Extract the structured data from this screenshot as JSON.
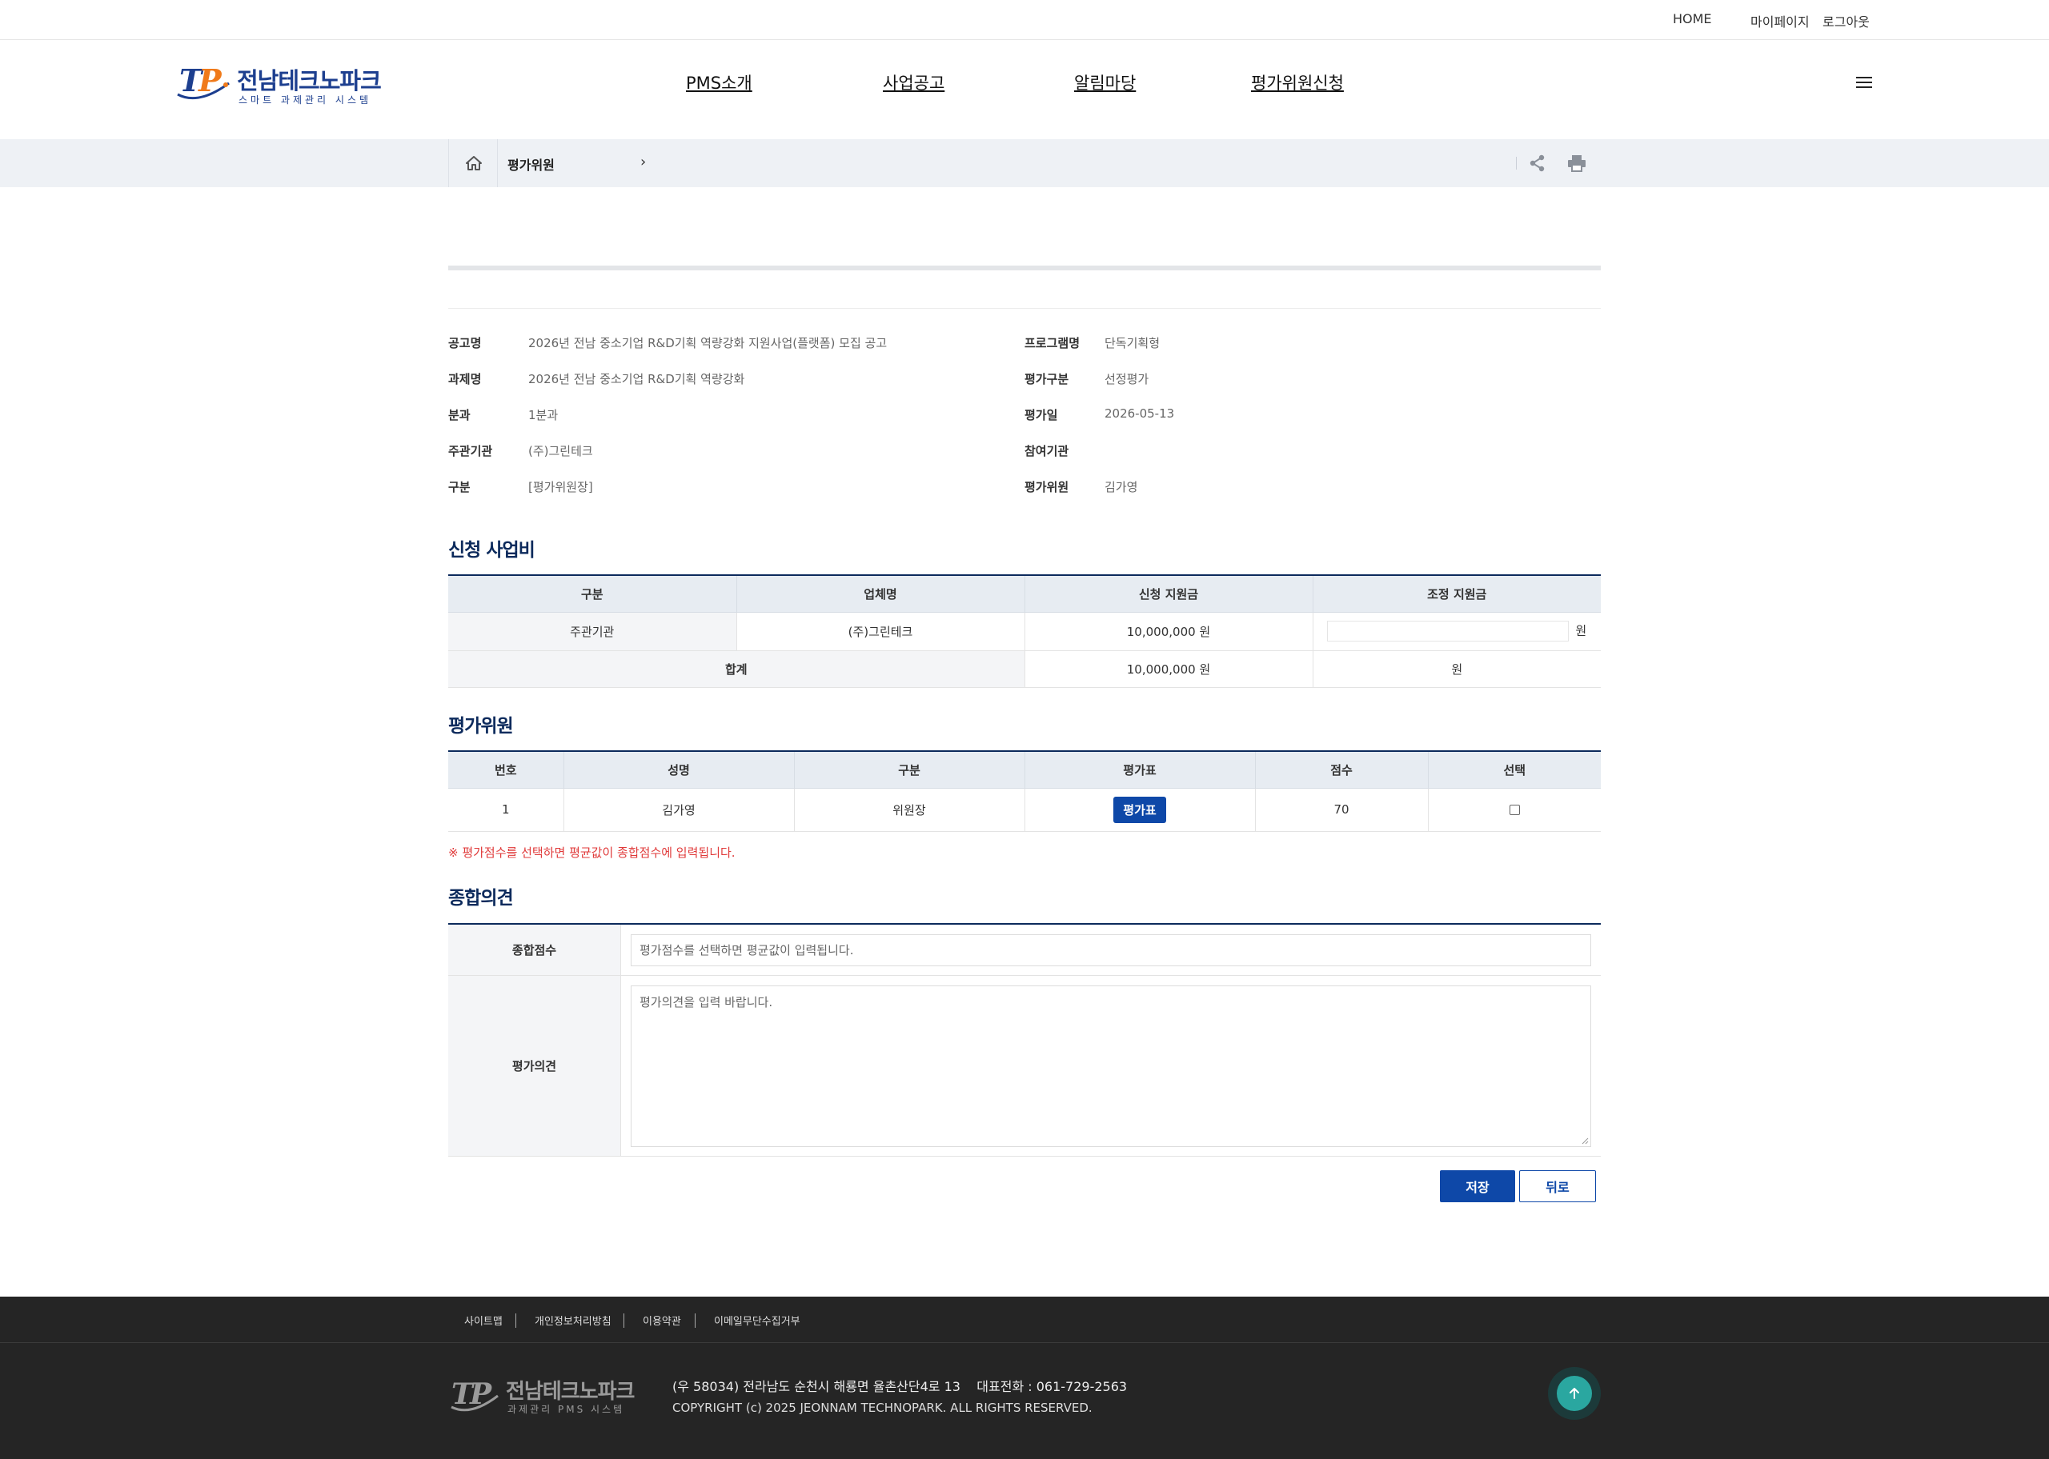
{
  "util_nav": {
    "home": "HOME",
    "mypage": "마이페이지",
    "logout": "로그아웃"
  },
  "logo": {
    "name": "전남테크노파크",
    "subtitle": "스마트 과제관리 시스템",
    "mark": "TP"
  },
  "gnb": [
    "PMS소개",
    "사업공고",
    "알림마당",
    "평가위원신청"
  ],
  "breadcrumb": {
    "current": "평가위원",
    "chevron": "›"
  },
  "info": {
    "left": [
      {
        "label": "공고명",
        "value": "2026년 전남 중소기업 R&D기획 역량강화 지원사업(플랫폼) 모집 공고"
      },
      {
        "label": "과제명",
        "value": "2026년 전남 중소기업 R&D기획 역량강화"
      },
      {
        "label": "분과",
        "value": "1분과"
      },
      {
        "label": "주관기관",
        "value": "(주)그린테크"
      },
      {
        "label": "구분",
        "value": "[평가위원장]"
      }
    ],
    "right": [
      {
        "label": "프로그램명",
        "value": "단독기획형"
      },
      {
        "label": "평가구분",
        "value": "선정평가"
      },
      {
        "label": "평가일",
        "value": "2026-05-13"
      },
      {
        "label": "참여기관",
        "value": ""
      },
      {
        "label": "평가위원",
        "value": "김가영"
      }
    ]
  },
  "budget": {
    "title": "신청 사업비",
    "headers": [
      "구분",
      "업체명",
      "신청 지원금",
      "조정 지원금"
    ],
    "rows": [
      {
        "type": "주관기관",
        "company": "(주)그린테크",
        "requested": "10,000,000 원",
        "adjusted_input": "",
        "adjusted_unit": "원"
      }
    ],
    "total": {
      "label": "합계",
      "requested": "10,000,000 원",
      "adjusted": "원"
    }
  },
  "evaluators": {
    "title": "평가위원",
    "headers": [
      "번호",
      "성명",
      "구분",
      "평가표",
      "점수",
      "선택"
    ],
    "rows": [
      {
        "no": "1",
        "name": "김가영",
        "role": "위원장",
        "sheet_button": "평가표",
        "score": "70",
        "selected": false
      }
    ],
    "notice": "※ 평가점수를 선택하면 평균값이 종합점수에 입력됩니다."
  },
  "opinion": {
    "title": "종합의견",
    "score_label": "종합점수",
    "score_placeholder": "평가점수를 선택하면 평균값이 입력됩니다.",
    "opinion_label": "평가의견",
    "opinion_placeholder": "평가의견을 입력 바랍니다."
  },
  "actions": {
    "save": "저장",
    "back": "뒤로"
  },
  "footer": {
    "links": [
      "사이트맵",
      "개인정보처리방침",
      "이용약관",
      "이메일무단수집거부"
    ],
    "logo_name": "전남테크노파크",
    "logo_subtitle": "과제관리 PMS 시스템",
    "address": "(우 58034) 전라남도 순천시 해룡면 율촌산단4로 13    대표전화 : 061-729-2563",
    "copyright": "COPYRIGHT (c) 2025 JEONNAM TECHNOPARK. ALL RIGHTS RESERVED."
  },
  "colors": {
    "primary": "#0e48a8",
    "navy": "#0c2a5c",
    "accent_orange": "#f07a1a",
    "notice_red": "#e03a3a",
    "footer_bg": "#252525",
    "top_btn": "#2aa7a0"
  },
  "icons": {
    "home": "home-icon",
    "share": "share-icon",
    "print": "print-icon",
    "menu": "hamburger-icon",
    "top": "arrow-up-icon"
  }
}
